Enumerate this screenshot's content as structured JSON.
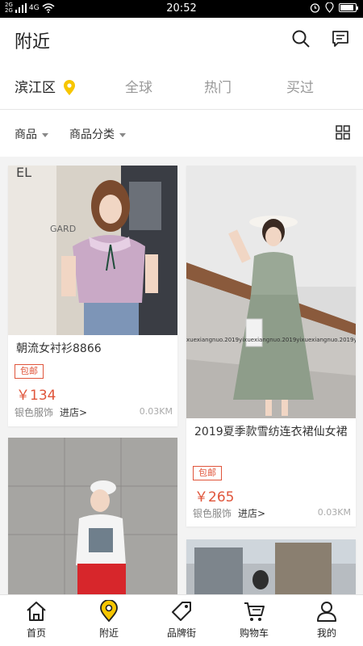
{
  "status_bar": {
    "net_top": "2G",
    "net_bottom": "2G",
    "net_type": "4G",
    "time": "20:52",
    "icons": [
      "signal-icon",
      "wifi-icon",
      "alarm-icon",
      "location-icon",
      "battery-icon"
    ]
  },
  "header": {
    "title": "附近",
    "icons": [
      "search-icon",
      "message-icon"
    ]
  },
  "location_tabs": [
    {
      "label": "滨江区",
      "active": true
    },
    {
      "label": "全球",
      "active": false
    },
    {
      "label": "热门",
      "active": false
    },
    {
      "label": "买过",
      "active": false
    }
  ],
  "filters": [
    {
      "label": "商品"
    },
    {
      "label": "商品分类"
    }
  ],
  "products": [
    {
      "name": "朝流女衬衫8866",
      "badge": "包邮",
      "price": "￥134",
      "shop": "银色服饰",
      "shop_link": "进店>",
      "distance": "0.03KM"
    },
    {
      "name": "2019夏季款雪纺连衣裙仙女裙",
      "badge": "包邮",
      "price": "￥265",
      "shop": "银色服饰",
      "shop_link": "进店>",
      "distance": "0.03KM",
      "watermark": "xuexiangnuo.2019yixuexiangnuo.2019yixuexiangnuo.2019yi"
    }
  ],
  "tab_bar": [
    {
      "label": "首页",
      "icon": "home-icon"
    },
    {
      "label": "附近",
      "icon": "location-pin-icon",
      "active": true
    },
    {
      "label": "品牌街",
      "icon": "tag-icon"
    },
    {
      "label": "购物车",
      "icon": "cart-icon"
    },
    {
      "label": "我的",
      "icon": "user-icon"
    }
  ],
  "colors": {
    "accent_yellow": "#f7c600",
    "price_red": "#e0553b",
    "muted_text": "#999999"
  }
}
